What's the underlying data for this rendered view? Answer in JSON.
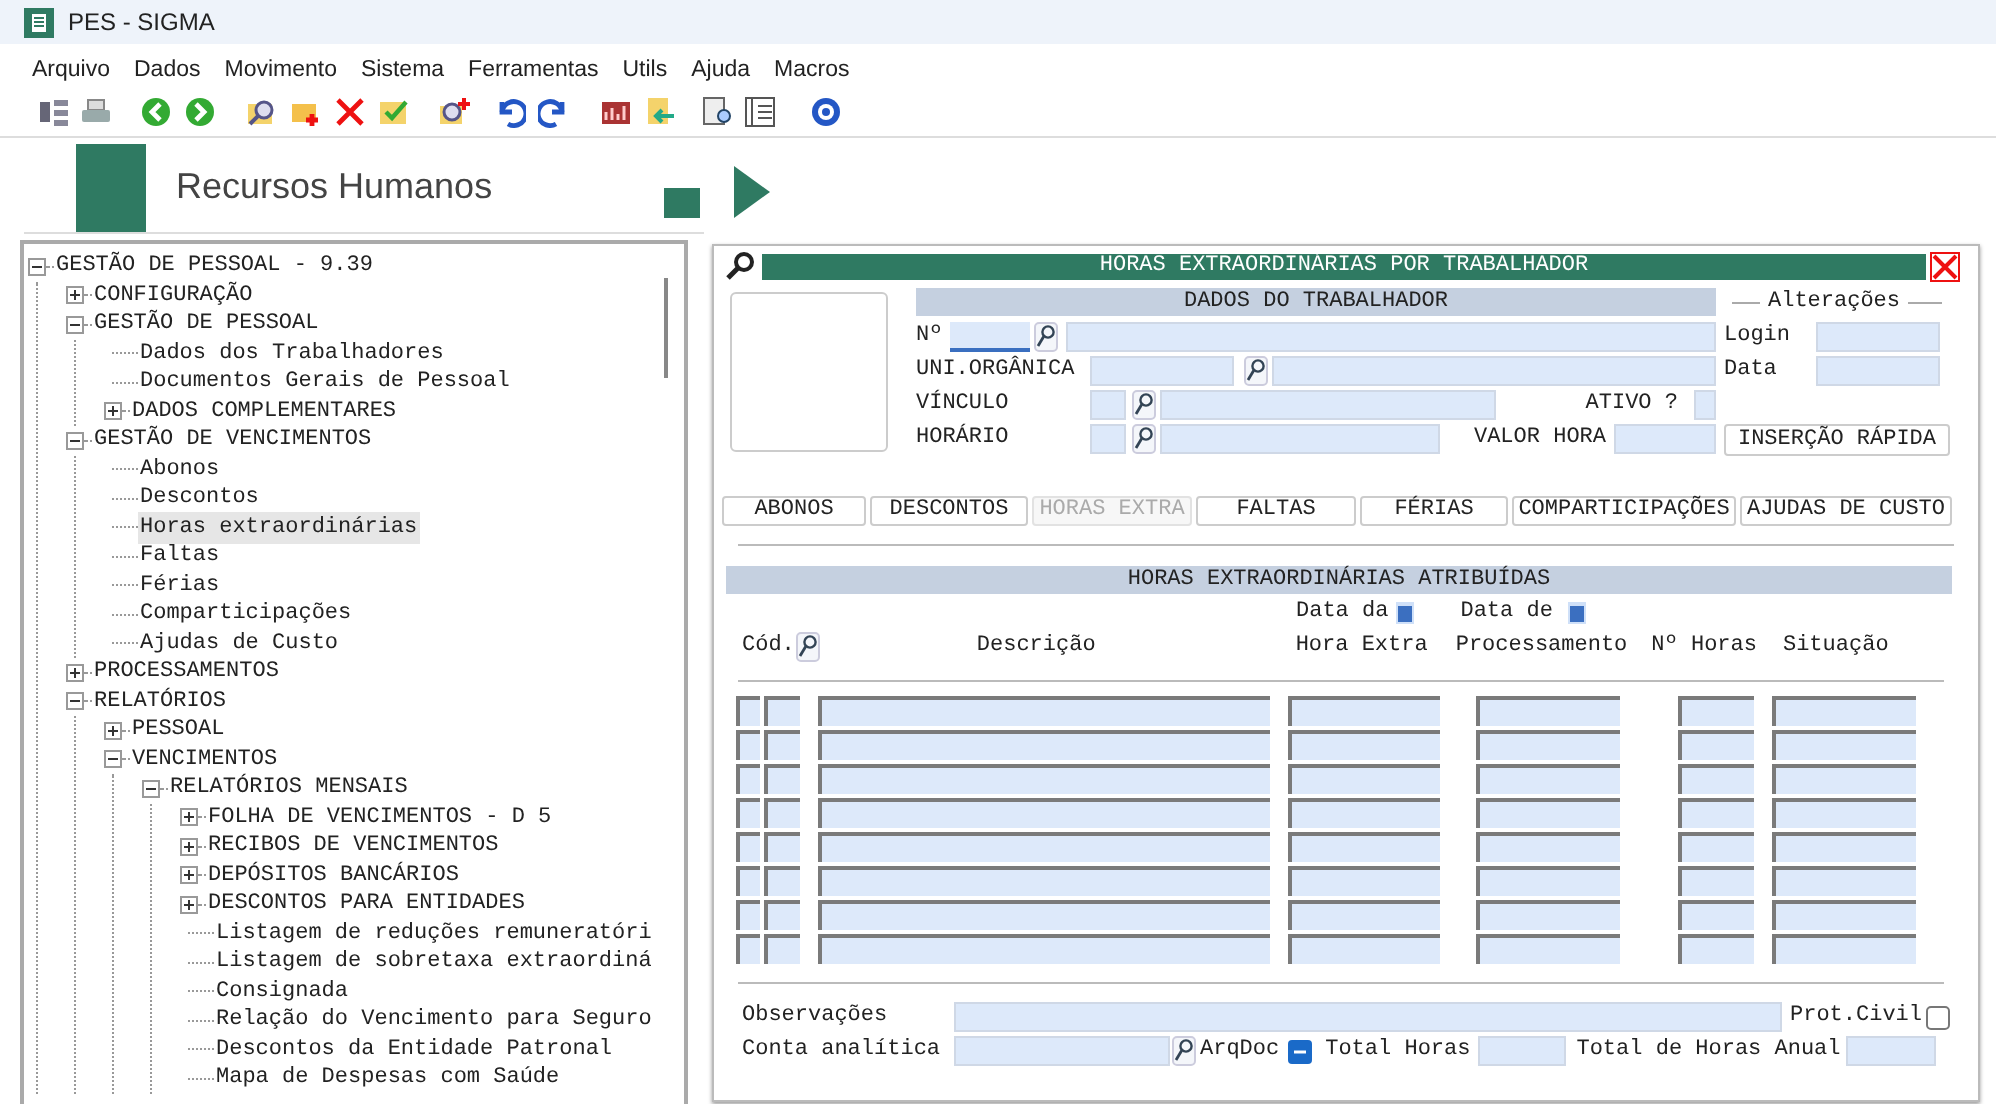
{
  "window": {
    "title": "PES - SIGMA"
  },
  "menu": [
    "Arquivo",
    "Dados",
    "Movimento",
    "Sistema",
    "Ferramentas",
    "Utils",
    "Ajuda",
    "Macros"
  ],
  "banner": {
    "title": "Recursos Humanos"
  },
  "tree": [
    {
      "label": "GESTÃO DE PESSOAL - 9.39",
      "kind": "folder",
      "expanded": true,
      "selected": false,
      "children": [
        {
          "label": "CONFIGURAÇÃO",
          "kind": "folder",
          "expanded": false,
          "selected": false
        },
        {
          "label": "GESTÃO DE PESSOAL",
          "kind": "folder",
          "expanded": true,
          "selected": false,
          "children": [
            {
              "label": "Dados dos Trabalhadores",
              "kind": "leaf",
              "selected": false
            },
            {
              "label": "Documentos Gerais de Pessoal",
              "kind": "leaf",
              "selected": false
            },
            {
              "label": "DADOS COMPLEMENTARES",
              "kind": "folder",
              "expanded": false,
              "selected": false
            }
          ]
        },
        {
          "label": "GESTÃO DE VENCIMENTOS",
          "kind": "folder",
          "expanded": true,
          "selected": false,
          "children": [
            {
              "label": "Abonos",
              "kind": "leaf",
              "selected": false
            },
            {
              "label": "Descontos",
              "kind": "leaf",
              "selected": false
            },
            {
              "label": "Horas extraordinárias",
              "kind": "leaf",
              "selected": true
            },
            {
              "label": "Faltas",
              "kind": "leaf",
              "selected": false
            },
            {
              "label": "Férias",
              "kind": "leaf",
              "selected": false
            },
            {
              "label": "Comparticipações",
              "kind": "leaf",
              "selected": false
            },
            {
              "label": "Ajudas de Custo",
              "kind": "leaf",
              "selected": false
            }
          ]
        },
        {
          "label": "PROCESSAMENTOS",
          "kind": "folder",
          "expanded": false,
          "selected": false
        },
        {
          "label": "RELATÓRIOS",
          "kind": "folder",
          "expanded": true,
          "selected": false,
          "children": [
            {
              "label": "PESSOAL",
              "kind": "folder",
              "expanded": false,
              "selected": false
            },
            {
              "label": "VENCIMENTOS",
              "kind": "folder",
              "expanded": true,
              "selected": false,
              "children": [
                {
                  "label": "RELATÓRIOS MENSAIS",
                  "kind": "folder",
                  "expanded": true,
                  "selected": false,
                  "children": [
                    {
                      "label": "FOLHA DE VENCIMENTOS - D 5",
                      "kind": "folder",
                      "expanded": false,
                      "selected": false
                    },
                    {
                      "label": "RECIBOS DE VENCIMENTOS",
                      "kind": "folder",
                      "expanded": false,
                      "selected": false
                    },
                    {
                      "label": "DEPÓSITOS BANCÁRIOS",
                      "kind": "folder",
                      "expanded": false,
                      "selected": false
                    },
                    {
                      "label": "DESCONTOS PARA ENTIDADES",
                      "kind": "folder",
                      "expanded": false,
                      "selected": false
                    },
                    {
                      "label": "Listagem de reduções remuneratóri",
                      "kind": "leaf",
                      "selected": false
                    },
                    {
                      "label": "Listagem de sobretaxa extraordiná",
                      "kind": "leaf",
                      "selected": false
                    },
                    {
                      "label": "Consignada",
                      "kind": "leaf",
                      "selected": false
                    },
                    {
                      "label": "Relação do Vencimento para Seguro",
                      "kind": "leaf",
                      "selected": false
                    },
                    {
                      "label": "Descontos da Entidade Patronal",
                      "kind": "leaf",
                      "selected": false
                    },
                    {
                      "label": "Mapa de Despesas com Saúde",
                      "kind": "leaf",
                      "selected": false
                    }
                  ]
                }
              ]
            }
          ]
        }
      ]
    }
  ],
  "form": {
    "title": "HORAS EXTRAORDINÁRIAS POR TRABALHADOR",
    "worker": {
      "title": "DADOS DO TRABALHADOR",
      "number": "Nº",
      "org_unit": "UNI.ORGÂNICA",
      "link": "VÍNCULO",
      "active": "ATIVO ?",
      "schedule": "HORÁRIO",
      "hourly_value": "VALOR HORA"
    },
    "changes": {
      "title": "Alterações",
      "login": "Login",
      "date": "Data"
    },
    "quick_insert": "INSERÇÃO RÁPIDA",
    "tabs": [
      {
        "label": "ABONOS",
        "selected": false
      },
      {
        "label": "DESCONTOS",
        "selected": false
      },
      {
        "label": "HORAS EXTRA",
        "selected": true
      },
      {
        "label": "FALTAS",
        "selected": false
      },
      {
        "label": "FÉRIAS",
        "selected": false
      },
      {
        "label": "COMPARTICIPAÇÕES",
        "selected": false
      },
      {
        "label": "AJUDAS DE CUSTO",
        "selected": false
      }
    ],
    "overtime": {
      "title": "HORAS EXTRAORDINÁRIAS ATRIBUÍDAS",
      "code": "Cód.",
      "description": "Descrição",
      "date_top": "Data da",
      "date_bottom": "Hora Extra",
      "processing_top": "Data de",
      "processing_bottom": "Processamento",
      "hours": "Nº Horas",
      "status": "Situação"
    },
    "notes": "Observações",
    "civil_protection": {
      "label": "Prot.Civil",
      "checked": false
    },
    "account": "Conta analítica",
    "arqdoc": "ArqDoc",
    "total_hours": "Total Horas",
    "annual_hours": "Total de Horas Anual"
  }
}
